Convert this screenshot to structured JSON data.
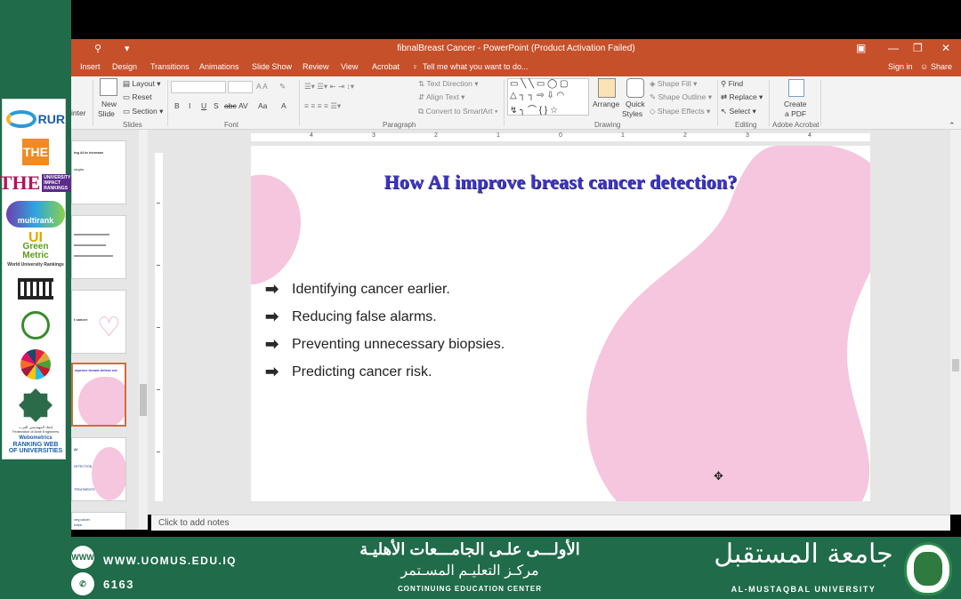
{
  "window": {
    "title": "fibnalBreast Cancer - PowerPoint (Product Activation Failed)",
    "sign_in": "Sign in",
    "share": "Share"
  },
  "tabs": [
    "Insert",
    "Design",
    "Transitions",
    "Animations",
    "Slide Show",
    "Review",
    "View",
    "Acrobat"
  ],
  "tell_me": "Tell me what you want to do...",
  "ribbon": {
    "inter_label": "inter",
    "new_slide": [
      "New",
      "Slide"
    ],
    "slides_cmds": [
      "Layout",
      "Reset",
      "Section"
    ],
    "font_btns": [
      "B",
      "I",
      "U",
      "S",
      "abc",
      "AV",
      "Aa",
      "A"
    ],
    "paragraph_cmds": [
      "Text Direction",
      "Align Text",
      "Convert to SmartArt"
    ],
    "arrange": "Arrange",
    "quick_styles": [
      "Quick",
      "Styles"
    ],
    "shape_cmds": [
      "Shape Fill",
      "Shape Outline",
      "Shape Effects"
    ],
    "editing_cmds": [
      "Find",
      "Replace",
      "Select"
    ],
    "create_pdf": [
      "Create",
      "a PDF"
    ],
    "groups": [
      "Slides",
      "Font",
      "Paragraph",
      "Drawing",
      "Editing",
      "Adobe Acrobat"
    ]
  },
  "ruler": {
    "h_labels": [
      "4",
      "3",
      "2",
      "1",
      "0",
      "1",
      "2",
      "3",
      "4"
    ]
  },
  "thumbnails": [
    {
      "lines": [
        "ing AI to increase",
        "",
        "",
        "",
        "ntegies"
      ]
    },
    {
      "lines": [
        "",
        "",
        "",
        ""
      ]
    },
    {
      "lines": [
        "t cancer"
      ]
    },
    {
      "lines": [
        "mprove breast deteot ext"
      ],
      "selected": true
    },
    {
      "lines": [
        "AI",
        "DETECTION",
        "",
        "TREATMENTS"
      ]
    },
    {
      "lines": [
        "ving cancer",
        "ection"
      ]
    }
  ],
  "slide": {
    "title": "How AI improve breast cancer detection?",
    "bullets": [
      "Identifying cancer earlier.",
      "Reducing false alarms.",
      "Preventing unnecessary biopsies.",
      "Predicting cancer risk."
    ]
  },
  "notes_placeholder": "Click to add notes",
  "logos": {
    "rur": "RUR",
    "the": "THE",
    "the_impact": [
      "UNIVERSITY",
      "IMPACT",
      "RANKINGS"
    ],
    "multirank": "multirank",
    "greenmetric": [
      "UI",
      "Green",
      "Metric",
      "World University Rankings"
    ],
    "fed_arab": "إتحاد المهندسين العرب",
    "fed_en": "Federation of Arab Engineers",
    "webometrics": [
      "Webometrics",
      "RANKING WEB",
      "OF UNIVERSITIES"
    ]
  },
  "banner": {
    "www_icon": "WWW",
    "site": "WWW.UOMUS.EDU.IQ",
    "phone": "6163",
    "arabic_line1": "الأولـــى علـى الجامـــعات الأهليـة",
    "arabic_line2": "مركـز التعليـم المسـتمر",
    "center_en": "CONTINUING EDUCATION CENTER",
    "university_ar": "جامعة المستقبل",
    "university_en": "AL-MUSTAQBAL UNIVERSITY"
  },
  "colors": {
    "accent": "#c6502a",
    "banner_green": "#1f6b4a",
    "blob_pink": "#f5c6dd",
    "title_blue": "#3c35c8"
  }
}
